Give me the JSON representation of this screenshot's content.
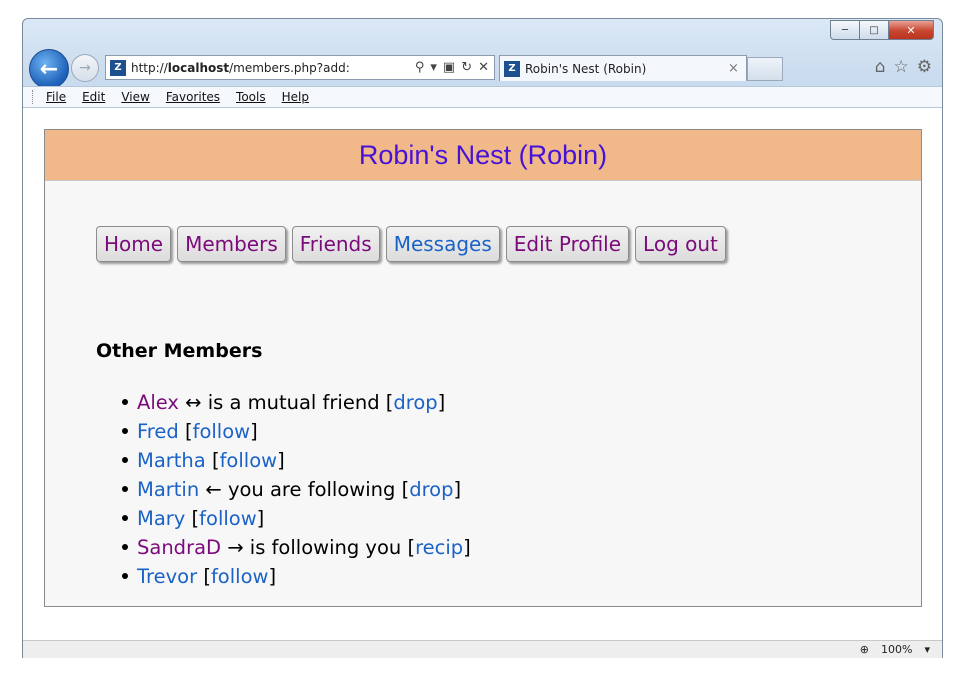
{
  "browser": {
    "address_url": "http://localhost/members.php?add:",
    "address_url_prefix": "http://",
    "address_url_host": "localhost",
    "address_url_rest": "/members.php?add:",
    "tab_title": "Robin's Nest (Robin)",
    "zoom": "100%"
  },
  "menu": [
    "File",
    "Edit",
    "View",
    "Favorites",
    "Tools",
    "Help"
  ],
  "page": {
    "banner": "Robin's Nest (Robin)",
    "nav": [
      {
        "label": "Home",
        "color": "#7b0a7b"
      },
      {
        "label": "Members",
        "color": "#7b0a7b"
      },
      {
        "label": "Friends",
        "color": "#7b0a7b"
      },
      {
        "label": "Messages",
        "color": "#1b62c7"
      },
      {
        "label": "Edit Profile",
        "color": "#7b0a7b"
      },
      {
        "label": "Log out",
        "color": "#7b0a7b"
      }
    ],
    "heading": "Other Members",
    "members": [
      {
        "name": "Alex",
        "status": " ↔ is a mutual friend ",
        "action": "drop"
      },
      {
        "name": "Fred",
        "status": " ",
        "action": "follow"
      },
      {
        "name": "Martha",
        "status": " ",
        "action": "follow"
      },
      {
        "name": "Martin",
        "status": " ← you are following ",
        "action": "drop"
      },
      {
        "name": "Mary",
        "status": " ",
        "action": "follow"
      },
      {
        "name": "SandraD",
        "status": " → is following you ",
        "action": "recip"
      },
      {
        "name": "Trevor",
        "status": " ",
        "action": "follow"
      }
    ]
  },
  "colors": {
    "banner_bg": "#f1b989",
    "banner_text": "#4611d8",
    "link": "#1b62c7",
    "visited": "#7b0a7b"
  }
}
